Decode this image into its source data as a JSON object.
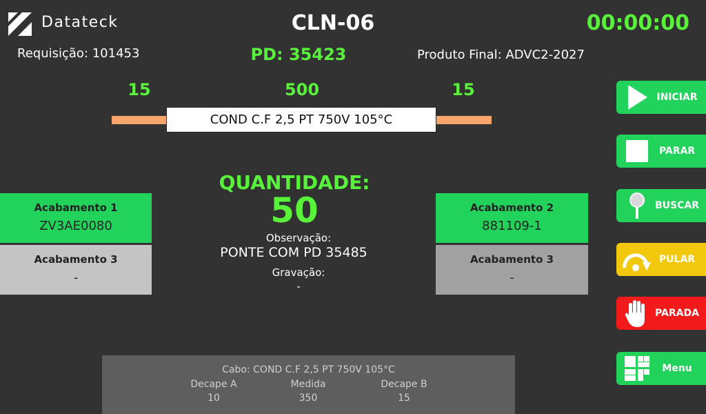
{
  "header": {
    "brand": "Datateck",
    "machine": "CLN-06",
    "timer": "00:00:00",
    "requisicao": "Requisição:  101453",
    "pd": "PD: 35423",
    "produto_final": "Produto Final: ADVC2-2027"
  },
  "cable": {
    "left_length": "15",
    "center_length": "500",
    "right_length": "15",
    "description": "COND C.F 2,5 PT 750V 105°C"
  },
  "center": {
    "quantidade_label": "QUANTIDADE:",
    "quantidade_value": "50",
    "observacao_label": "Observação:",
    "observacao_value": "PONTE COM PD 35485",
    "gravacao_label": "Gravação:",
    "gravacao_value": "-"
  },
  "acabamentos": {
    "left_top": {
      "title": "Acabamento 1",
      "value": "ZV3AE0080"
    },
    "left_bottom": {
      "title": "Acabamento 3",
      "value": "-"
    },
    "right_top": {
      "title": "Acabamento 2",
      "value": "881109-1"
    },
    "right_bottom": {
      "title": "Acabamento 3",
      "value": "-"
    }
  },
  "buttons": {
    "iniciar": "INICIAR",
    "parar": "PARAR",
    "buscar": "BUSCAR",
    "pular": "PULAR",
    "parada": "PARADA",
    "menu": "Menu"
  },
  "bottom_panel": {
    "cabo": "Cabo: COND C.F 2,5 PT 750V 105°C",
    "decape_a_label": "Decape A",
    "decape_a_value": "10",
    "medida_label": "Medida",
    "medida_value": "350",
    "decape_b_label": "Decape B",
    "decape_b_value": "15"
  },
  "colors": {
    "background": "#323232",
    "accent_green": "#59f23a",
    "button_green": "#21d35b",
    "button_yellow": "#f2c80c",
    "button_red": "#f21a1a",
    "wire": "#f7a66b"
  },
  "icons": {
    "logo": "datateck-logo-icon",
    "iniciar": "play-icon",
    "parar": "stop-icon",
    "buscar": "pin-icon",
    "pular": "skip-icon",
    "parada": "hand-icon",
    "menu": "grid-icon"
  }
}
